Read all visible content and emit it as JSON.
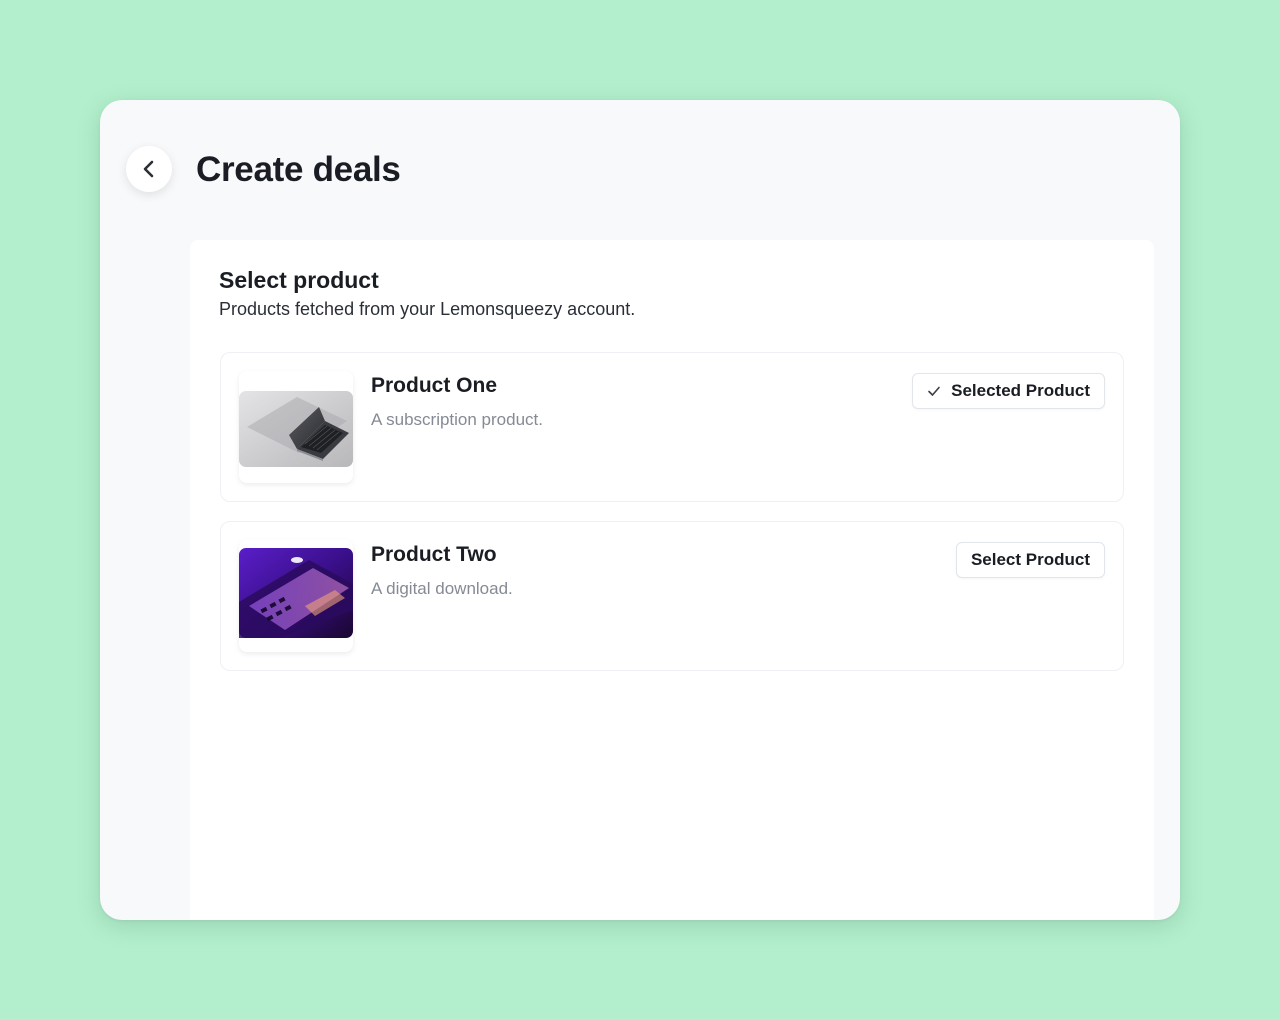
{
  "header": {
    "title": "Create deals",
    "back_icon": "chevron-left-icon"
  },
  "section": {
    "title": "Select product",
    "subtitle": "Products fetched from your Lemonsqueezy account."
  },
  "products": [
    {
      "name": "Product One",
      "description": "A subscription product.",
      "thumbnail": "laptop-silver-image",
      "button_label": "Selected Product",
      "selected": true,
      "button_icon": "check-icon"
    },
    {
      "name": "Product Two",
      "description": "A digital download.",
      "thumbnail": "laptop-purple-image",
      "button_label": "Select Product",
      "selected": false
    }
  ],
  "colors": {
    "background": "#b3efcd",
    "window": "#f8f9fb",
    "panel": "#ffffff",
    "text_primary": "#1a1d23",
    "text_muted": "#858a94"
  }
}
